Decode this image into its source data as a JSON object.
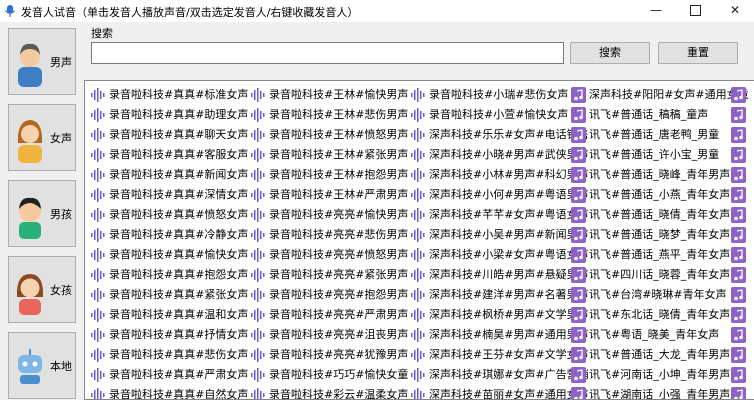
{
  "window": {
    "title": "发音人试音（单击发音人播放声音/双击选定发音人/右键收藏发音人）",
    "min_glyph": "—",
    "close_glyph": "✕"
  },
  "categories": [
    {
      "label": "男声",
      "icon": "man-avatar-icon"
    },
    {
      "label": "女声",
      "icon": "woman-avatar-icon"
    },
    {
      "label": "男孩",
      "icon": "boy-avatar-icon"
    },
    {
      "label": "女孩",
      "icon": "girl-avatar-icon"
    },
    {
      "label": "本地",
      "icon": "local-robot-icon"
    }
  ],
  "search": {
    "label": "搜索",
    "value": "",
    "button": "搜索",
    "reset": "重置"
  },
  "voices": {
    "col1": [
      "录音啦科技#真真#标准女声",
      "录音啦科技#真真#助理女声",
      "录音啦科技#真真#聊天女声",
      "录音啦科技#真真#客服女声",
      "录音啦科技#真真#新闻女声",
      "录音啦科技#真真#深情女声",
      "录音啦科技#真真#愤怒女声",
      "录音啦科技#真真#冷静女声",
      "录音啦科技#真真#愉快女声",
      "录音啦科技#真真#抱怨女声",
      "录音啦科技#真真#紧张女声",
      "录音啦科技#真真#温和女声",
      "录音啦科技#真真#抒情女声",
      "录音啦科技#真真#悲伤女声",
      "录音啦科技#真真#严肃女声",
      "录音啦科技#真真#自然女声"
    ],
    "col2": [
      "录音啦科技#王林#愉快男声",
      "录音啦科技#王林#悲伤男声",
      "录音啦科技#王林#愤怒男声",
      "录音啦科技#王林#紧张男声",
      "录音啦科技#王林#抱怨男声",
      "录音啦科技#王林#严肃男声",
      "录音啦科技#亮亮#愉快男声",
      "录音啦科技#亮亮#悲伤男声",
      "录音啦科技#亮亮#愤怒男声",
      "录音啦科技#亮亮#紧张男声",
      "录音啦科技#亮亮#抱怨男声",
      "录音啦科技#亮亮#严肃男声",
      "录音啦科技#亮亮#沮丧男声",
      "录音啦科技#亮亮#犹豫男声",
      "录音啦科技#巧巧#愉快女童",
      "录音啦科技#彩云#温柔女声"
    ],
    "col3": [
      "录音啦科技#小瑞#悲伤女声",
      "录音啦科技#小萱#愉快女声",
      "深声科技#乐乐#女声#电话销售",
      "深声科技#小晓#男声#武侠男声",
      "深声科技#小林#男声#科幻男声",
      "深声科技#小何#男声#粤语男声",
      "深声科技#芊芊#女声#粤语女声",
      "深声科技#小吴#男声#新闻男声",
      "深声科技#小梁#女声#粤语女声",
      "深声科技#川皓#男声#悬疑男声",
      "深声科技#建洋#男声#名著男声",
      "深声科技#枫桥#男声#文学男声",
      "深声科技#楠昊#男声#通用男声",
      "深声科技#王芬#女声#文学女声",
      "深声科技#琪娜#女声#广告营销",
      "深声科技#苗丽#女声#通用女声"
    ],
    "col4": [
      "深声科技#阳阳#女声#通用女童",
      "讯飞#普通话_稿稿_童声",
      "讯飞#普通话_唐老鸭_男童",
      "讯飞#普通话_许小宝_男童",
      "讯飞#普通话_晓峰_青年男声",
      "讯飞#普通话_小燕_青年女声",
      "讯飞#普通话_晓倩_青年女声",
      "讯飞#普通话_晓梦_青年女声",
      "讯飞#普通话_燕平_青年女声",
      "讯飞#四川话_晓蓉_青年女声",
      "讯飞#台湾#晓琳#青年女声",
      "讯飞#东北话_晓倩_青年女声",
      "讯飞#粤语_晓美_青年女声",
      "讯飞#普通话_大龙_青年男声",
      "讯飞#河南话_小坤_青年男声",
      "讯飞#湖南话_小强_青年男声"
    ]
  },
  "colors": {
    "voice_wave": "#6a5acd",
    "note_badge": "#8e62c9",
    "window_bg": "#f0f0f0"
  }
}
